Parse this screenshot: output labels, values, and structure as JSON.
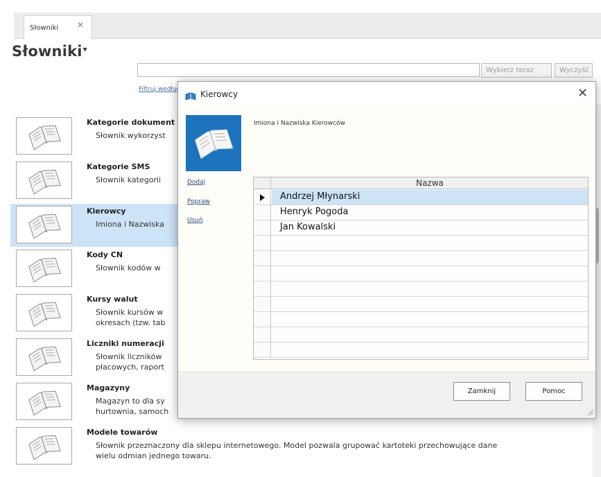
{
  "tab": {
    "label": "Słowniki",
    "close": "✕"
  },
  "page": {
    "title": "Słowniki"
  },
  "toolbar": {
    "search_value": "",
    "select_button": "Wybierz teraz",
    "clear_button": "Wyczyść",
    "filter_link": "Filtruj według"
  },
  "dictionaries": [
    {
      "name": "Kategorie dokument",
      "desc": [
        "Słownik wykorzyst"
      ]
    },
    {
      "name": "Kategorie SMS",
      "desc": [
        "Słownik kategorii"
      ]
    },
    {
      "name": "Kierowcy",
      "desc": [
        "Imiona i Nazwiska"
      ]
    },
    {
      "name": "Kody CN",
      "desc": [
        "Słownik kodów w"
      ]
    },
    {
      "name": "Kursy walut",
      "desc": [
        "Słownik kursów w",
        "okresach (tzw. tab"
      ]
    },
    {
      "name": "Liczniki numeracji",
      "desc": [
        "Słownik liczników",
        "płacowych, raport"
      ]
    },
    {
      "name": "Magazyny",
      "desc": [
        "Magazyn to dla sy",
        "hurtownia, samoch"
      ]
    },
    {
      "name": "Modele towarów",
      "desc": [
        "Słownik przeznaczony dla sklepu internetowego. Model pozwala grupować kartoteki przechowujące dane",
        "wielu odmian jednego towaru."
      ]
    }
  ],
  "dialog": {
    "title": "Kierowcy",
    "description": "Imiona i Nazwiska Kierowców",
    "actions": {
      "add": "Dodaj",
      "edit": "Popraw",
      "delete": "Usuń"
    },
    "grid": {
      "column": "Nazwa",
      "rows": [
        "Andrzej Młynarski",
        "Henryk Pogoda",
        "Jan Kowalski"
      ],
      "selected_index": 0
    },
    "buttons": {
      "close": "Zamknij",
      "help": "Pomoc"
    }
  },
  "colors": {
    "selection": "#cde3f7",
    "icon_box": "#1d74bd",
    "link": "#2a4d85"
  }
}
